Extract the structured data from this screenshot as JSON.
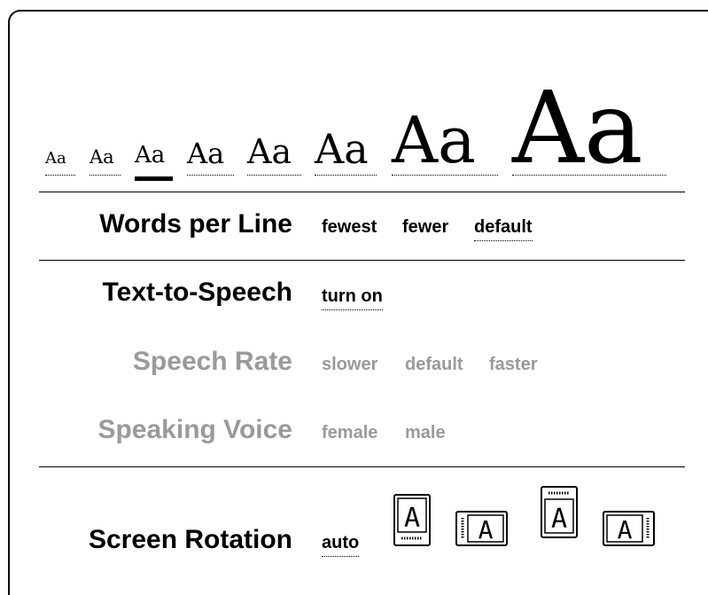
{
  "font_size": {
    "sample_text": "Aa",
    "selected_index": 2
  },
  "words_per_line": {
    "label": "Words per Line",
    "options": [
      "fewest",
      "fewer",
      "default"
    ],
    "selected": "default"
  },
  "text_to_speech": {
    "label": "Text-to-Speech",
    "option": "turn on"
  },
  "speech_rate": {
    "label": "Speech Rate",
    "options": [
      "slower",
      "default",
      "faster"
    ],
    "disabled": true
  },
  "speaking_voice": {
    "label": "Speaking Voice",
    "options": [
      "female",
      "male"
    ],
    "disabled": true
  },
  "screen_rotation": {
    "label": "Screen Rotation",
    "auto_label": "auto",
    "icon_letter": "A",
    "icons": [
      "portrait-icon",
      "landscape-right-icon",
      "portrait-inverted-icon",
      "landscape-left-icon"
    ]
  },
  "colors": {
    "disabled_text": "#9a9a9a",
    "foreground": "#000000"
  }
}
